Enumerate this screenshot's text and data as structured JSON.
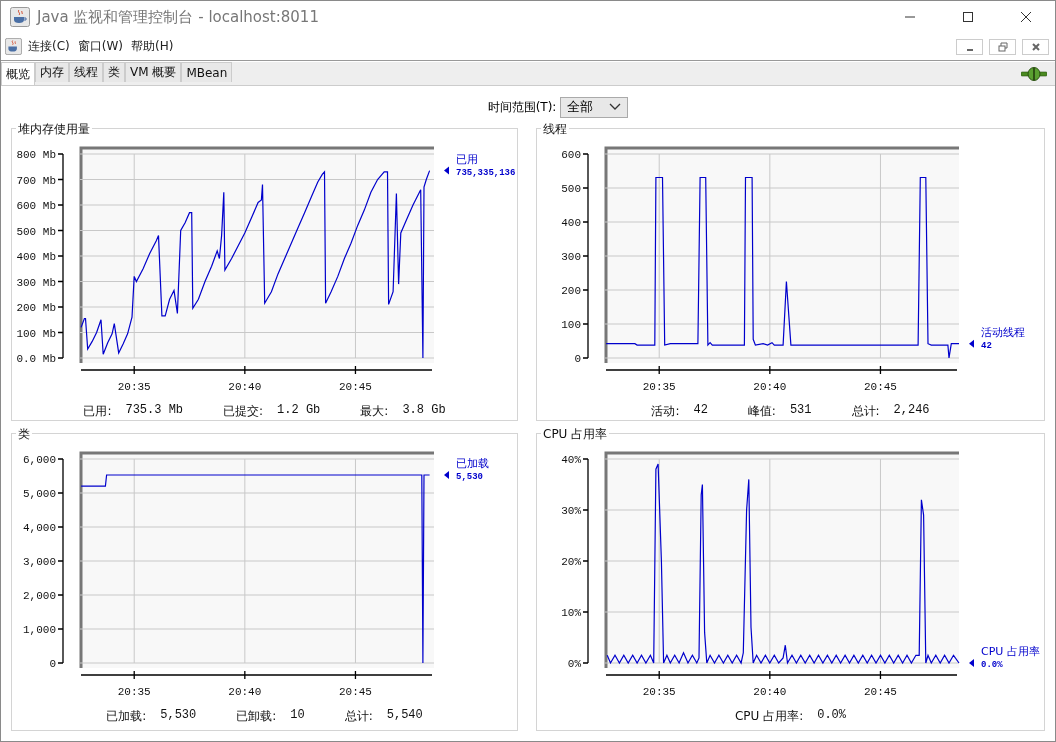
{
  "window": {
    "title": "Java 监视和管理控制台 - localhost:8011"
  },
  "menu_bar": {
    "items": [
      "连接(C)",
      "窗口(W)",
      "帮助(H)"
    ]
  },
  "tabs": [
    {
      "label": "概览",
      "selected": true
    },
    {
      "label": "内存",
      "selected": false
    },
    {
      "label": "线程",
      "selected": false
    },
    {
      "label": "类",
      "selected": false
    },
    {
      "label": "VM 概要",
      "selected": false
    },
    {
      "label": "MBean",
      "selected": false
    }
  ],
  "time_range": {
    "label": "时间范围(T):",
    "value": "全部"
  },
  "panels": [
    {
      "current_value": "735,335,136",
      "stats": [
        {
          "label": "已用:",
          "value": "735.3 Mb"
        },
        {
          "label": "已提交:",
          "value": "1.2 Gb"
        },
        {
          "label": "最大:",
          "value": "3.8 Gb"
        }
      ],
      "chart_data": {
        "type": "line",
        "grid": true,
        "title": "堆内存使用量",
        "xlim": [
          1232.55,
          1248.55
        ],
        "ylim": [
          0,
          800
        ],
        "xticks": [
          {
            "value": 1235,
            "label": "20:35"
          },
          {
            "value": 1240,
            "label": "20:40"
          },
          {
            "value": 1245,
            "label": "20:45"
          }
        ],
        "yticks": [
          {
            "value": 0,
            "label": "0.0 Mb"
          },
          {
            "value": 100,
            "label": "100 Mb"
          },
          {
            "value": 200,
            "label": "200 Mb"
          },
          {
            "value": 300,
            "label": "300 Mb"
          },
          {
            "value": 400,
            "label": "400 Mb"
          },
          {
            "value": 500,
            "label": "500 Mb"
          },
          {
            "value": 600,
            "label": "600 Mb"
          },
          {
            "value": 700,
            "label": "700 Mb"
          },
          {
            "value": 800,
            "label": "800 Mb"
          }
        ],
        "x": [
          1232.6,
          1232.75,
          1232.8,
          1232.9,
          1233.1,
          1233.3,
          1233.5,
          1233.6,
          1233.8,
          1234.0,
          1234.1,
          1234.3,
          1234.5,
          1234.7,
          1234.9,
          1235.0,
          1235.1,
          1235.4,
          1235.7,
          1236.0,
          1236.1,
          1236.25,
          1236.4,
          1236.6,
          1236.8,
          1236.95,
          1237.1,
          1237.3,
          1237.5,
          1237.6,
          1237.65,
          1237.9,
          1238.2,
          1238.5,
          1238.75,
          1238.85,
          1238.95,
          1239.05,
          1239.1,
          1239.4,
          1239.7,
          1240.0,
          1240.3,
          1240.6,
          1240.75,
          1240.8,
          1240.9,
          1241.2,
          1241.5,
          1241.8,
          1242.1,
          1242.4,
          1242.7,
          1243.0,
          1243.3,
          1243.5,
          1243.6,
          1243.65,
          1243.9,
          1244.2,
          1244.5,
          1244.8,
          1245.1,
          1245.4,
          1245.7,
          1246.0,
          1246.3,
          1246.45,
          1246.5,
          1246.7,
          1246.85,
          1246.95,
          1247.05,
          1247.3,
          1247.6,
          1247.95,
          1248.05,
          1248.1,
          1248.2,
          1248.35
        ],
        "series": [
          {
            "name": "已用",
            "color": "#0000cc",
            "values": [
              120,
              155,
              155,
              35,
              65,
              100,
              150,
              15,
              60,
              95,
              135,
              20,
              55,
              95,
              160,
              320,
              300,
              350,
              410,
              460,
              480,
              165,
              165,
              230,
              265,
              175,
              500,
              530,
              570,
              570,
              195,
              230,
              300,
              360,
              420,
              390,
              480,
              650,
              345,
              390,
              440,
              490,
              550,
              610,
              620,
              680,
              215,
              260,
              330,
              390,
              450,
              510,
              570,
              630,
              690,
              720,
              730,
              215,
              260,
              320,
              390,
              450,
              520,
              580,
              650,
              700,
              730,
              730,
              210,
              260,
              645,
              290,
              490,
              540,
              600,
              660,
              0,
              670,
              700,
              735
            ]
          }
        ]
      }
    },
    {
      "current_value": "42",
      "stats": [
        {
          "label": "活动:",
          "value": "42"
        },
        {
          "label": "峰值:",
          "value": "531"
        },
        {
          "label": "总计:",
          "value": "2,246"
        }
      ],
      "chart_data": {
        "type": "line",
        "grid": true,
        "title": "线程",
        "xlim": [
          1232.55,
          1248.55
        ],
        "ylim": [
          0,
          600
        ],
        "xticks": [
          {
            "value": 1235,
            "label": "20:35"
          },
          {
            "value": 1240,
            "label": "20:40"
          },
          {
            "value": 1245,
            "label": "20:45"
          }
        ],
        "yticks": [
          0,
          100,
          200,
          300,
          400,
          500,
          600
        ],
        "x": [
          1232.6,
          1233.9,
          1234.0,
          1234.8,
          1234.85,
          1235.15,
          1235.25,
          1235.5,
          1236.75,
          1236.85,
          1237.1,
          1237.2,
          1237.3,
          1237.4,
          1238.85,
          1238.9,
          1239.2,
          1239.25,
          1239.35,
          1239.7,
          1239.9,
          1240.1,
          1240.2,
          1240.6,
          1240.75,
          1240.95,
          1246.7,
          1246.8,
          1247.05,
          1247.15,
          1247.3,
          1248.05,
          1248.1,
          1248.2,
          1248.55
        ],
        "series": [
          {
            "name": "活动线程",
            "color": "#0000cc",
            "values": [
              42,
              42,
              38,
              38,
              531,
              531,
              38,
              42,
              42,
              531,
              531,
              38,
              45,
              38,
              38,
              531,
              531,
              55,
              38,
              42,
              38,
              45,
              38,
              38,
              225,
              38,
              38,
              531,
              531,
              42,
              38,
              38,
              0,
              42,
              42
            ]
          }
        ]
      }
    },
    {
      "current_value": "5,530",
      "stats": [
        {
          "label": "已加载:",
          "value": "5,530"
        },
        {
          "label": "已卸载:",
          "value": "10"
        },
        {
          "label": "总计:",
          "value": "5,540"
        }
      ],
      "chart_data": {
        "type": "line",
        "grid": true,
        "title": "类",
        "xlim": [
          1232.55,
          1248.55
        ],
        "ylim": [
          0,
          6000
        ],
        "xticks": [
          {
            "value": 1235,
            "label": "20:35"
          },
          {
            "value": 1240,
            "label": "20:40"
          },
          {
            "value": 1245,
            "label": "20:45"
          }
        ],
        "yticks": [
          {
            "value": 0,
            "label": "0"
          },
          {
            "value": 1000,
            "label": "1,000"
          },
          {
            "value": 2000,
            "label": "2,000"
          },
          {
            "value": 3000,
            "label": "3,000"
          },
          {
            "value": 4000,
            "label": "4,000"
          },
          {
            "value": 5000,
            "label": "5,000"
          },
          {
            "value": 6000,
            "label": "6,000"
          }
        ],
        "x": [
          1232.6,
          1233.7,
          1233.75,
          1248.0,
          1248.05,
          1248.1,
          1248.35
        ],
        "series": [
          {
            "name": "已加载",
            "color": "#0000cc",
            "values": [
              5200,
              5200,
              5530,
              5530,
              0,
              5530,
              5530
            ]
          }
        ]
      }
    },
    {
      "current_value": "0.0%",
      "stats": [
        {
          "label": "CPU 占用率:",
          "value": "0.0%"
        }
      ],
      "chart_data": {
        "type": "line",
        "grid": true,
        "title": "CPU 占用率",
        "xlim": [
          1232.55,
          1248.55
        ],
        "ylim": [
          0,
          40
        ],
        "xticks": [
          {
            "value": 1235,
            "label": "20:35"
          },
          {
            "value": 1240,
            "label": "20:40"
          },
          {
            "value": 1245,
            "label": "20:45"
          }
        ],
        "yticks": [
          {
            "value": 0,
            "label": "0%"
          },
          {
            "value": 10,
            "label": "10%"
          },
          {
            "value": 20,
            "label": "20%"
          },
          {
            "value": 30,
            "label": "30%"
          },
          {
            "value": 40,
            "label": "40%"
          }
        ],
        "x": [
          1232.65,
          1232.8,
          1233.0,
          1233.2,
          1233.4,
          1233.6,
          1233.8,
          1234.0,
          1234.2,
          1234.4,
          1234.6,
          1234.75,
          1234.85,
          1234.95,
          1235.1,
          1235.2,
          1235.35,
          1235.5,
          1235.7,
          1235.9,
          1236.1,
          1236.3,
          1236.5,
          1236.7,
          1236.8,
          1236.9,
          1236.95,
          1237.05,
          1237.15,
          1237.3,
          1237.5,
          1237.7,
          1237.9,
          1238.1,
          1238.3,
          1238.5,
          1238.7,
          1238.8,
          1238.95,
          1239.05,
          1239.15,
          1239.25,
          1239.4,
          1239.6,
          1239.8,
          1240.0,
          1240.2,
          1240.4,
          1240.6,
          1240.7,
          1240.8,
          1241.0,
          1241.2,
          1241.4,
          1241.6,
          1241.8,
          1242.0,
          1242.2,
          1242.4,
          1242.6,
          1242.8,
          1243.0,
          1243.2,
          1243.4,
          1243.6,
          1243.8,
          1244.0,
          1244.2,
          1244.4,
          1244.6,
          1244.8,
          1245.0,
          1245.2,
          1245.4,
          1245.6,
          1245.8,
          1246.0,
          1246.2,
          1246.4,
          1246.6,
          1246.75,
          1246.85,
          1246.95,
          1247.05,
          1247.15,
          1247.3,
          1247.5,
          1247.7,
          1247.9,
          1248.1,
          1248.3,
          1248.55
        ],
        "series": [
          {
            "name": "CPU 占用率",
            "color": "#0000cc",
            "values": [
              1.5,
              0,
              1.5,
              0,
              1.5,
              0,
              1.5,
              0,
              1.5,
              0,
              1.5,
              0,
              38,
              39,
              20,
              0,
              1.5,
              0,
              1.5,
              0,
              2,
              0,
              1.5,
              0,
              1,
              33,
              35,
              6,
              0,
              1.5,
              0,
              1.5,
              0,
              1.5,
              0,
              1.5,
              0,
              2,
              30,
              36,
              7,
              0,
              1.5,
              0,
              1.5,
              0,
              1.5,
              0,
              1,
              3.5,
              0,
              1.5,
              0,
              1.5,
              0,
              1.5,
              0,
              1.5,
              0,
              1.5,
              0,
              1.5,
              0,
              1.5,
              0,
              1.5,
              0,
              1.5,
              0,
              1.5,
              0,
              1.5,
              0,
              1.5,
              0,
              1.5,
              0,
              1.5,
              0,
              1.5,
              1.5,
              32,
              29,
              0,
              1.5,
              0,
              1.5,
              0,
              1.5,
              0,
              1.5,
              0
            ]
          }
        ]
      }
    }
  ]
}
